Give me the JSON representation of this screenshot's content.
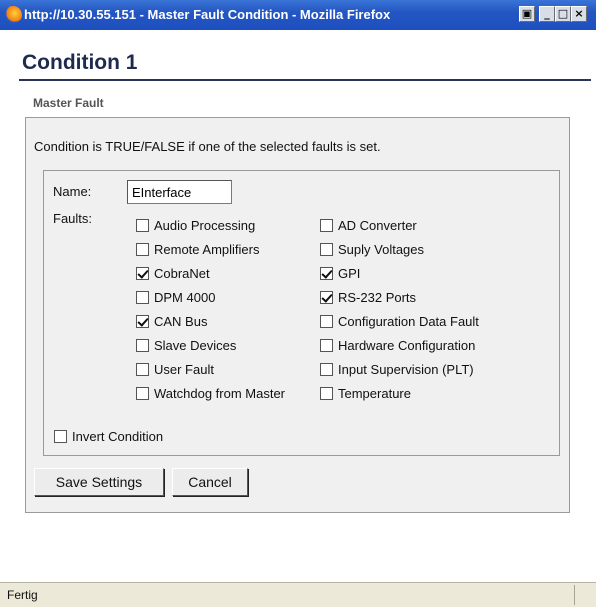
{
  "window": {
    "title": "http://10.30.55.151 - Master Fault Condition - Mozilla Firefox",
    "buttons": [
      "restore",
      "minimize",
      "maximize",
      "close"
    ]
  },
  "heading": "Condition 1",
  "section_title": "Master Fault",
  "description": "Condition is TRUE/FALSE if one of the selected faults is set.",
  "name_label": "Name:",
  "name_value": "EInterface",
  "faults_label": "Faults:",
  "faults_left": [
    {
      "label": "Audio Processing",
      "checked": false
    },
    {
      "label": "Remote Amplifiers",
      "checked": false
    },
    {
      "label": "CobraNet",
      "checked": true
    },
    {
      "label": "DPM 4000",
      "checked": false
    },
    {
      "label": "CAN Bus",
      "checked": true
    },
    {
      "label": "Slave Devices",
      "checked": false
    },
    {
      "label": "User Fault",
      "checked": false
    },
    {
      "label": "Watchdog from Master",
      "checked": false
    }
  ],
  "faults_right": [
    {
      "label": "AD Converter",
      "checked": false
    },
    {
      "label": "Suply Voltages",
      "checked": false
    },
    {
      "label": "GPI",
      "checked": true
    },
    {
      "label": "RS-232 Ports",
      "checked": true
    },
    {
      "label": "Configuration Data Fault",
      "checked": false
    },
    {
      "label": "Hardware Configuration",
      "checked": false
    },
    {
      "label": "Input Supervision (PLT)",
      "checked": false
    },
    {
      "label": "Temperature",
      "checked": false
    }
  ],
  "invert": {
    "label": "Invert Condition",
    "checked": false
  },
  "buttons": {
    "save": "Save Settings",
    "cancel": "Cancel"
  },
  "status": "Fertig",
  "icons": {
    "app": "firefox-icon"
  }
}
